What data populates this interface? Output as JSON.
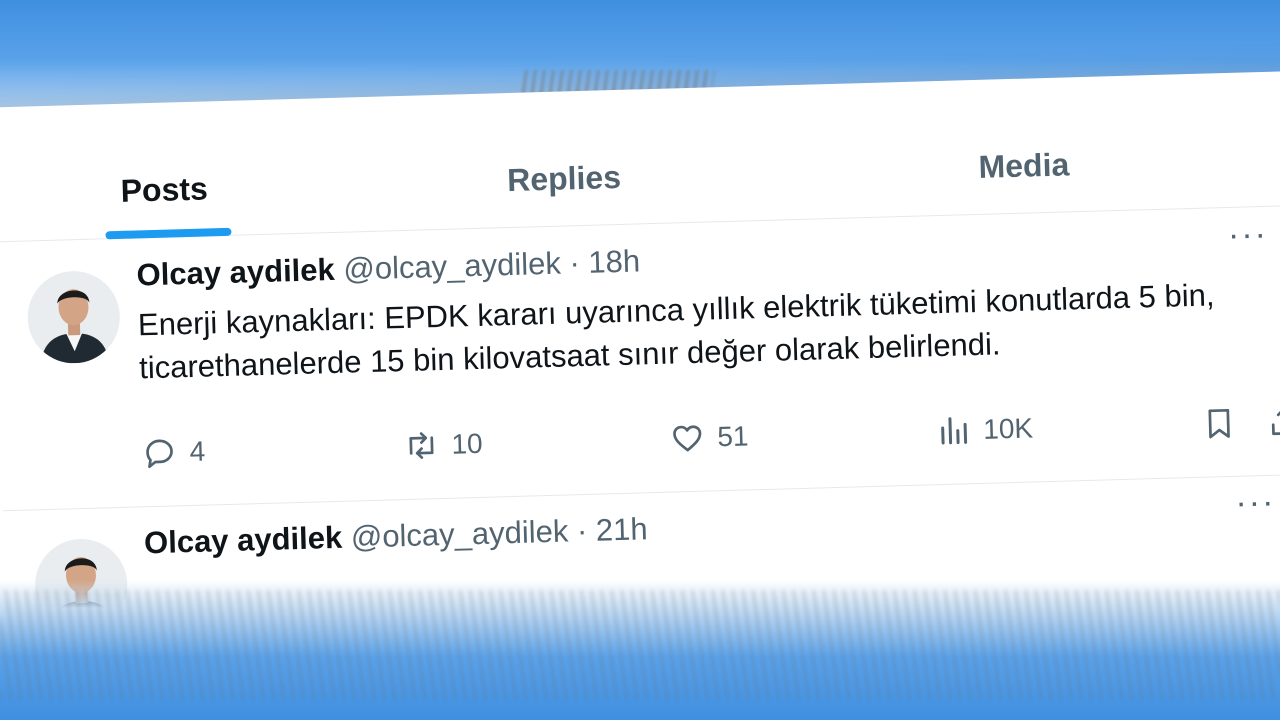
{
  "tabs": [
    {
      "label": "Posts",
      "active": true
    },
    {
      "label": "Replies",
      "active": false
    },
    {
      "label": "Media",
      "active": false
    }
  ],
  "tweets": [
    {
      "author": "Olcay aydilek",
      "handle": "@olcay_aydilek",
      "separator": "·",
      "time": "18h",
      "text": "Enerji kaynakları: EPDK kararı uyarınca yıllık elektrik tüketimi konutlarda 5 bin, ticarethanelerde 15 bin kilovatsaat sınır değer olarak belirlendi.",
      "more": "···",
      "actions": {
        "replies": "4",
        "reposts": "10",
        "likes": "51",
        "views": "10K"
      }
    },
    {
      "author": "Olcay aydilek",
      "handle": "@olcay_aydilek",
      "separator": "·",
      "time": "21h",
      "more": "···"
    }
  ],
  "colors": {
    "accent": "#1d9bf0",
    "text_primary": "#0f1419",
    "text_secondary": "#536471",
    "frame_blue": "#3f8fe0"
  },
  "icons": [
    "reply-icon",
    "repost-icon",
    "like-icon",
    "views-icon",
    "bookmark-icon",
    "share-icon",
    "more-icon"
  ]
}
